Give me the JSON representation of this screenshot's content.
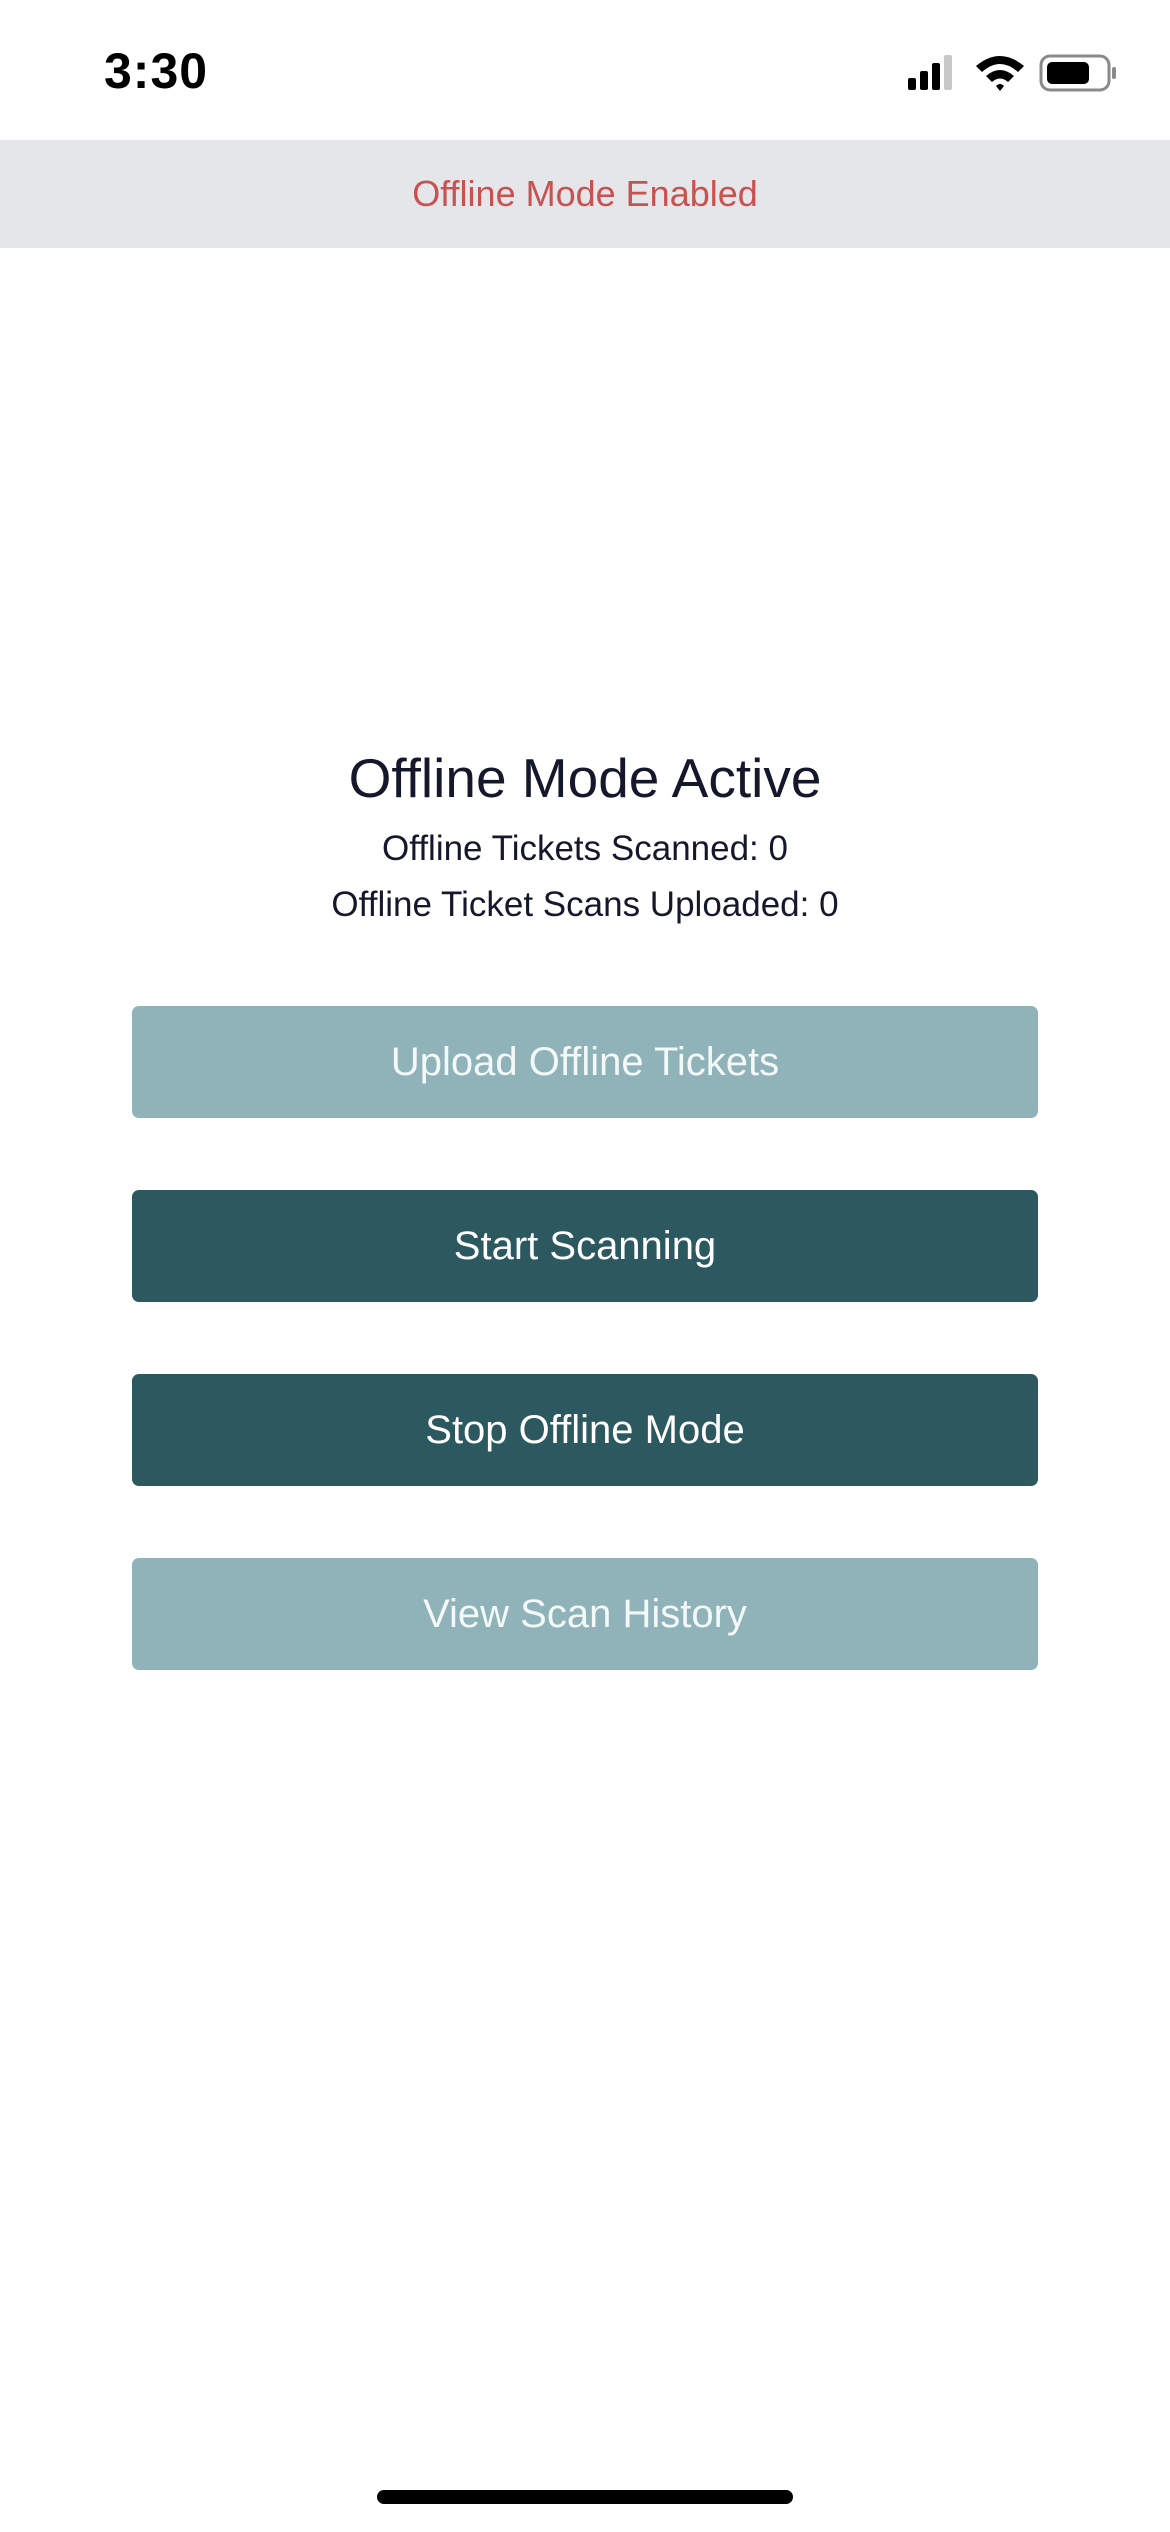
{
  "status_bar": {
    "time": "3:30",
    "icons": [
      "signal-icon",
      "wifi-icon",
      "battery-icon"
    ]
  },
  "banner": {
    "text": "Offline Mode Enabled"
  },
  "main": {
    "heading": "Offline Mode Active",
    "tickets_scanned": "Offline Tickets Scanned: 0",
    "scans_uploaded": "Offline Ticket Scans Uploaded: 0"
  },
  "buttons": {
    "upload_label": "Upload Offline Tickets",
    "start_label": "Start Scanning",
    "stop_label": "Stop Offline Mode",
    "history_label": "View Scan History"
  },
  "colors": {
    "banner_bg": "#e5e6e9",
    "banner_text": "#c9514f",
    "primary_button": "#2c5860",
    "disabled_button": "#8fb3b8",
    "text": "#15182b"
  }
}
